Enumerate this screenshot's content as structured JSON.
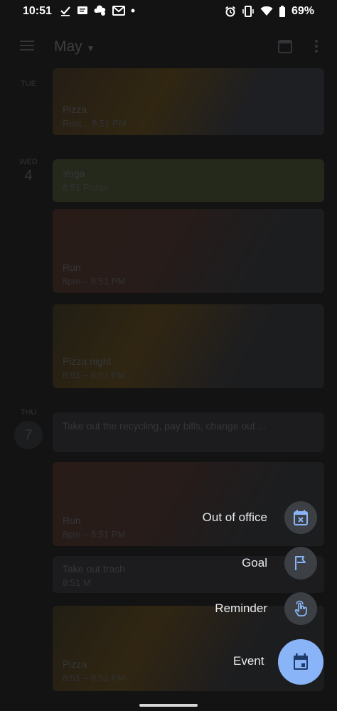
{
  "status_bar": {
    "time": "10:51",
    "left_icons": [
      "task-check-icon",
      "message-icon",
      "cloud-sync-icon",
      "gmail-icon",
      "dot-icon"
    ],
    "right_icons": [
      "alarm-icon",
      "vibrate-icon",
      "wifi-icon",
      "battery-icon"
    ],
    "battery": "69%"
  },
  "appbar": {
    "month": "May"
  },
  "days": [
    {
      "dow": "TUE",
      "num": "",
      "id": "tue"
    },
    {
      "dow": "WED",
      "num": "4",
      "id": "wed"
    },
    {
      "dow": "THU",
      "num": "7",
      "id": "thu"
    }
  ],
  "events": [
    {
      "title": "Pizza",
      "time": "Rest... 8:51 PM"
    },
    {
      "title": "Yoga",
      "time": "8:51 Pistas"
    },
    {
      "title": "Run",
      "time": "8pm – 8:51 PM"
    },
    {
      "title": "Pizza night",
      "time": "8:51 – 8:51 PM"
    },
    {
      "title": "Take out the recycling, pay bills, change out ..."
    },
    {
      "title": "Run",
      "time": "8pm – 8:51 PM"
    },
    {
      "title": "Take out trash",
      "time": "8:51 M"
    },
    {
      "title": "Pizza",
      "time": "8:51 – 8:51 PM"
    }
  ],
  "fab_menu": {
    "out_of_office": "Out of office",
    "goal": "Goal",
    "reminder": "Reminder",
    "event": "Event"
  },
  "colors": {
    "accent": "#8ab4f8",
    "mini_fab": "#3c4045",
    "background": "#1e1e20"
  }
}
